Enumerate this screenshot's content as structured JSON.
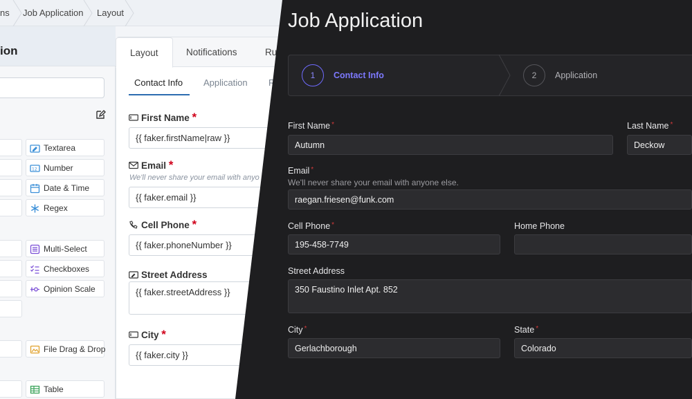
{
  "breadcrumbs": [
    "ns",
    "Job Application",
    "Layout"
  ],
  "left_panel": {
    "title": "ion",
    "components": [
      {
        "label": "Textarea",
        "icon": "textarea-icon"
      },
      {
        "label": "Number",
        "icon": "number-icon"
      },
      {
        "label": "Date & Time",
        "icon": "calendar-icon"
      },
      {
        "label": "Regex",
        "icon": "asterisk-icon"
      },
      {
        "label": "Multi-Select",
        "icon": "multi-select-icon"
      },
      {
        "label": "Checkboxes",
        "icon": "checkbox-list-icon"
      },
      {
        "label": "Opinion Scale",
        "icon": "opinion-scale-icon"
      },
      {
        "label": "File Drag & Drop",
        "icon": "image-upload-icon"
      },
      {
        "label": "Table",
        "icon": "table-icon"
      }
    ]
  },
  "editor": {
    "tabs": [
      "Layout",
      "Notifications",
      "Ru"
    ],
    "subtabs": [
      "Contact Info",
      "Application",
      "R"
    ],
    "fields": [
      {
        "label": "First Name",
        "required": "*",
        "value": "{{ faker.firstName|raw }}",
        "help": ""
      },
      {
        "label": "Email",
        "required": "*",
        "value": "{{ faker.email }}",
        "help": "We'll never share your email with anyo"
      },
      {
        "label": "Cell Phone",
        "required": "*",
        "value": "{{ faker.phoneNumber }}",
        "help": ""
      },
      {
        "label": "Street Address",
        "required": "",
        "value": "{{ faker.streetAddress }}",
        "help": ""
      },
      {
        "label": "City",
        "required": "*",
        "value": "{{ faker.city }}",
        "help": ""
      }
    ]
  },
  "preview": {
    "title": "Job Application",
    "steps": [
      {
        "number": "1",
        "label": "Contact Info"
      },
      {
        "number": "2",
        "label": "Application"
      }
    ],
    "fields": {
      "first_name": {
        "label": "First Name",
        "required": "*",
        "value": "Autumn"
      },
      "last_name": {
        "label": "Last Name",
        "required": "*",
        "value": "Deckow"
      },
      "email": {
        "label": "Email",
        "required": "*",
        "help": "We'll never share your email with anyone else.",
        "value": "raegan.friesen@funk.com"
      },
      "cell_phone": {
        "label": "Cell Phone",
        "required": "*",
        "value": "195-458-7749"
      },
      "home_phone": {
        "label": "Home Phone",
        "value": ""
      },
      "street_address": {
        "label": "Street Address",
        "value": "350 Faustino Inlet Apt. 852"
      },
      "city": {
        "label": "City",
        "required": "*",
        "value": "Gerlachborough"
      },
      "state": {
        "label": "State",
        "required": "*",
        "value": "Colorado"
      }
    }
  },
  "colors": {
    "accent_light": "#2b6cb0",
    "required_red": "#d0021b",
    "step_active": "#7d79ff",
    "dark_bg": "#1e1e20"
  }
}
